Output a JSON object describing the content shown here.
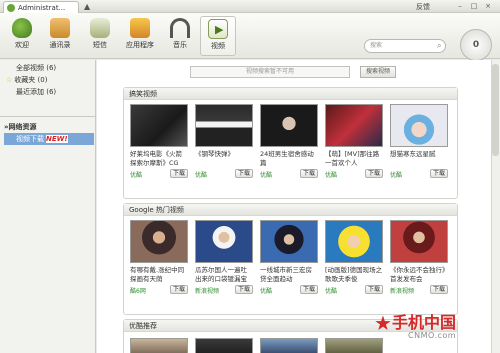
{
  "window": {
    "tab_title": "Administrat...",
    "feedback": "反馈",
    "minimize": "–",
    "maximize": "□",
    "close": "×"
  },
  "toolbar": {
    "items": [
      {
        "label": "欢迎",
        "icon": "peas-icon"
      },
      {
        "label": "通讯录",
        "icon": "contacts-icon"
      },
      {
        "label": "短信",
        "icon": "sms-icon"
      },
      {
        "label": "应用程序",
        "icon": "apps-icon"
      },
      {
        "label": "音乐",
        "icon": "headphones-icon"
      },
      {
        "label": "视频",
        "icon": "video-icon"
      }
    ],
    "search_placeholder": "搜索",
    "counter": "0"
  },
  "sidebar": {
    "all_videos": "全部视频 (6)",
    "favorites": "收藏夹 (0)",
    "recent": "最近添加 (6)",
    "net_header": "»网络资源",
    "video_download": "视频下载",
    "new_badge": "NEW!"
  },
  "content": {
    "search_placeholder": "视频搜索暂不可用",
    "search_button": "搜索视频",
    "sections": [
      {
        "title": "搞笑视频",
        "videos": [
          {
            "title": "好莱坞电影《火箭探索尔摩斯》CG",
            "source": "优酷",
            "download": "下载"
          },
          {
            "title": "《钢琴快弹》",
            "source": "优酷",
            "download": "下载"
          },
          {
            "title": "24班男生宿舍感动篇",
            "source": "优酷",
            "download": "下载"
          },
          {
            "title": "【萌】[MV]那往路一首欢个人",
            "source": "优酷",
            "download": "下载"
          },
          {
            "title": "想猫寒东远星腻",
            "source": "优酷",
            "download": "下载"
          }
        ]
      },
      {
        "title": "Google 热门视频",
        "videos": [
          {
            "title": "有哪有戴.涨纪中同探画有天荫",
            "source": "酷6网",
            "download": "下载"
          },
          {
            "title": "瓜苏尔国人一遍吐出来的口袋镀漏宝",
            "source": "新浪视频",
            "download": "下载"
          },
          {
            "title": "一线城市新三宏房贷全面趋动",
            "source": "优酷",
            "download": "下载"
          },
          {
            "title": "[动画版]德国现场之歌歌夫季俊",
            "source": "优酷",
            "download": "下载"
          },
          {
            "title": "《你永远不会独行》首发发布会",
            "source": "新浪视频",
            "download": "下载"
          }
        ]
      },
      {
        "title": "优酷推荐",
        "videos": []
      }
    ]
  },
  "watermark": {
    "cn": "手机中国",
    "en": "CNMO.com"
  },
  "colors": {
    "accent": "#7aa7d8",
    "source_green": "#2a8a2a",
    "watermark_red": "#d42a2a"
  }
}
